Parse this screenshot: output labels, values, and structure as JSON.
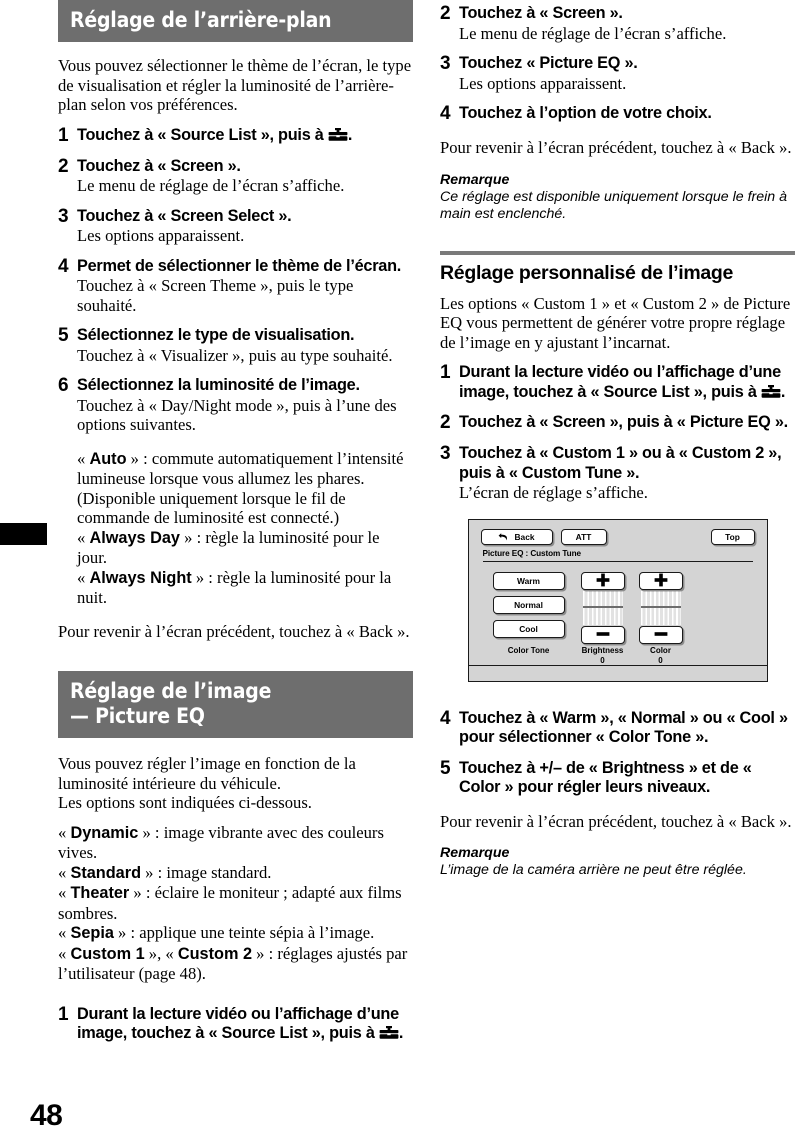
{
  "page": {
    "number": "48",
    "icon_toolbox": "toolbox-icon"
  },
  "left_column": {
    "banner1": {
      "line1": "Réglage de l’arrière-plan"
    },
    "intro1": "Vous pouvez sélectionner le thème de l’écran, le type de visualisation et régler la luminosité de l’arrière-plan selon vos préférences.",
    "steps1": [
      {
        "num": "1",
        "title_pre": "Touchez à « Source List », puis à ",
        "title_post": ".",
        "desc": ""
      },
      {
        "num": "2",
        "title": "Touchez à « Screen ».",
        "desc": "Le menu de réglage de l’écran s’affiche."
      },
      {
        "num": "3",
        "title": "Touchez à « Screen Select ».",
        "desc": "Les options apparaissent."
      },
      {
        "num": "4",
        "title": "Permet de sélectionner le thème de l’écran.",
        "desc": "Touchez à « Screen Theme », puis le type souhaité."
      },
      {
        "num": "5",
        "title": "Sélectionnez le type de visualisation.",
        "desc": "Touchez à « Visualizer », puis au type souhaité."
      },
      {
        "num": "6",
        "title": "Sélectionnez la luminosité de l’image.",
        "desc": "Touchez à « Day/Night mode », puis à l’une des options suivantes."
      }
    ],
    "options1": [
      {
        "name": "Auto",
        "open": "« ",
        "close": " » : ",
        "text": "commute automatiquement l’intensité lumineuse lorsque vous allumez les phares. (Disponible uniquement lorsque le fil de commande de luminosité est connecté.)"
      },
      {
        "name": "Always Day",
        "open": "« ",
        "close": " » : ",
        "text": "règle la luminosité pour le jour."
      },
      {
        "name": "Always Night",
        "open": "« ",
        "close": " » : ",
        "text": "règle la luminosité pour la nuit."
      }
    ],
    "back_note1": "Pour revenir à l’écran précédent, touchez à « Back ».",
    "banner2": {
      "line1": "Réglage de l’image",
      "line2": "— Picture EQ"
    },
    "intro2_l1": "Vous pouvez régler l’image en fonction de la luminosité intérieure du véhicule.",
    "intro2_l2": "Les options sont indiquées ci-dessous.",
    "options2": [
      {
        "name": "Dynamic",
        "open": "« ",
        "close": " » : ",
        "text": "image vibrante avec des couleurs vives."
      },
      {
        "name": "Standard",
        "open": "« ",
        "close": " » : ",
        "text": "image standard."
      },
      {
        "name": "Theater",
        "open": "« ",
        "close": " » : ",
        "text": "éclaire le moniteur ; adapté aux films sombres."
      },
      {
        "name": "Sepia",
        "open": "« ",
        "close": " » : ",
        "text": "applique une teinte sépia à l’image."
      },
      {
        "name": "Custom 1",
        "name2": "Custom 2",
        "open": "« ",
        "mid": " », « ",
        "close": " » : ",
        "text": "réglages ajustés par l’utilisateur (page 48)."
      }
    ],
    "step_bottom": {
      "num": "1",
      "title_pre": "Durant la lecture vidéo ou l’affichage d’une image, touchez à « Source List », puis à ",
      "title_post": "."
    }
  },
  "right_column": {
    "steps_top": [
      {
        "num": "2",
        "title": "Touchez à « Screen ».",
        "desc": "Le menu de réglage de l’écran s’affiche."
      },
      {
        "num": "3",
        "title": "Touchez « Picture EQ ».",
        "desc": "Les options apparaissent."
      },
      {
        "num": "4",
        "title": "Touchez à l’option de votre choix.",
        "desc": ""
      }
    ],
    "back_note_top": "Pour revenir à l’écran précédent, touchez à « Back ».",
    "note_top": {
      "title": "Remarque",
      "text": "Ce réglage est disponible uniquement lorsque le frein à main est enclenché."
    },
    "heading2": "Réglage personnalisé de l’image",
    "intro3": "Les options « Custom 1 » et « Custom 2 » de Picture EQ vous permettent de générer votre propre réglage de l’image en y ajustant l’incarnat.",
    "steps_mid": [
      {
        "num": "1",
        "title_pre": "Durant la lecture vidéo ou l’affichage d’une image, touchez à « Source List », puis à ",
        "title_post": ".",
        "desc": ""
      },
      {
        "num": "2",
        "title": "Touchez à « Screen », puis à « Picture EQ ».",
        "desc": ""
      },
      {
        "num": "3",
        "title": "Touchez à « Custom 1 » ou à « Custom 2 », puis à « Custom Tune ».",
        "desc": "L’écran de réglage s’affiche."
      }
    ],
    "steps_bottom": [
      {
        "num": "4",
        "title": "Touchez à « Warm », « Normal » ou « Cool » pour sélectionner « Color Tone ».",
        "desc": ""
      },
      {
        "num": "5",
        "title": "Touchez à +/– de « Brightness » et de « Color » pour régler leurs niveaux.",
        "desc": ""
      }
    ],
    "back_note_bottom": "Pour revenir à l’écran précédent, touchez à « Back ».",
    "note_bottom": {
      "title": "Remarque",
      "text": "L’image de la caméra arrière ne peut être réglée."
    }
  },
  "device_screen": {
    "back_button": "Back",
    "att_button": "ATT",
    "top_button": "Top",
    "title": "Picture EQ : Custom Tune",
    "tone_buttons": [
      "Warm",
      "Normal",
      "Cool"
    ],
    "plus_sign": "✚",
    "minus_sign": "▬",
    "labels": {
      "color_tone": "Color Tone",
      "brightness": "Brightness",
      "brightness_value": "0",
      "color": "Color",
      "color_value": "0"
    }
  },
  "colors": {
    "banner_gray": "#6e6e6e",
    "rule_gray": "#7a7a7a",
    "device_bg": "#d4d4d4",
    "device_border": "#1a1a1a"
  }
}
